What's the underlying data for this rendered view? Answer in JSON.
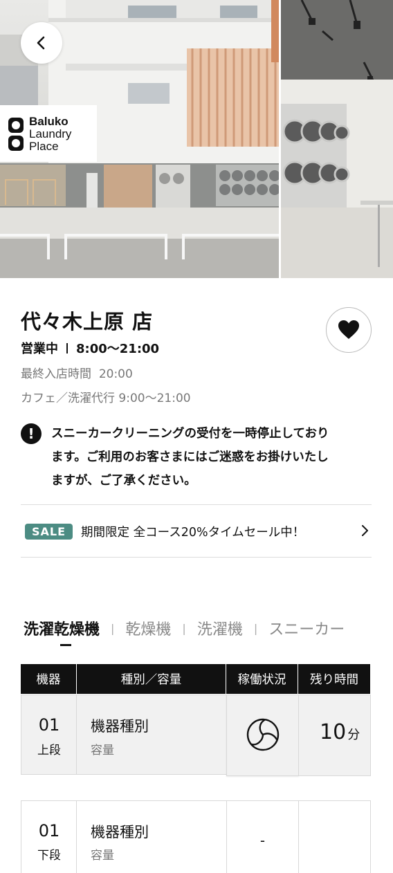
{
  "hero": {
    "logo_line1": "Baluko",
    "logo_line2": "Laundry",
    "logo_line3": "Place"
  },
  "store": {
    "name": "代々木上原 店",
    "status": "営業中",
    "hours": "8:00〜21:00",
    "last_entry_label": "最終入店時間",
    "last_entry_time": "20:00",
    "cafe_hours": "カフェ／洗濯代行 9:00〜21:00"
  },
  "notice": {
    "icon": "!",
    "line1": "スニーカークリーニングの受付を一時停止しており",
    "line2": "ます。ご利用のお客さまにはご迷惑をお掛けいたし",
    "line3": "ますが、ご了承ください。"
  },
  "sale": {
    "badge": "SALE",
    "text": "期間限定 全コース20%タイムセール中！"
  },
  "tabs": [
    "洗濯乾燥機",
    "乾燥機",
    "洗濯機",
    "スニーカー"
  ],
  "table": {
    "headers": [
      "機器",
      "種別／容量",
      "稼働状況",
      "残り時間"
    ],
    "rows": [
      {
        "no": "01",
        "position": "上段",
        "type": "機器種別",
        "capacity": "容量",
        "status": "running",
        "remaining": "10",
        "unit": "分"
      },
      {
        "no": "01",
        "position": "下段",
        "type": "機器種別",
        "capacity": "容量",
        "status": "-",
        "remaining": "",
        "unit": ""
      }
    ]
  },
  "icons": {
    "back": "chevron-left-icon",
    "favorite": "heart-icon",
    "notice": "exclamation-circle-icon",
    "sale_arrow": "chevron-right-icon",
    "running": "spinning-drum-icon"
  },
  "colors": {
    "sale_badge": "#4c8c83",
    "table_header": "#111111",
    "active_row": "#f1f1f1"
  }
}
